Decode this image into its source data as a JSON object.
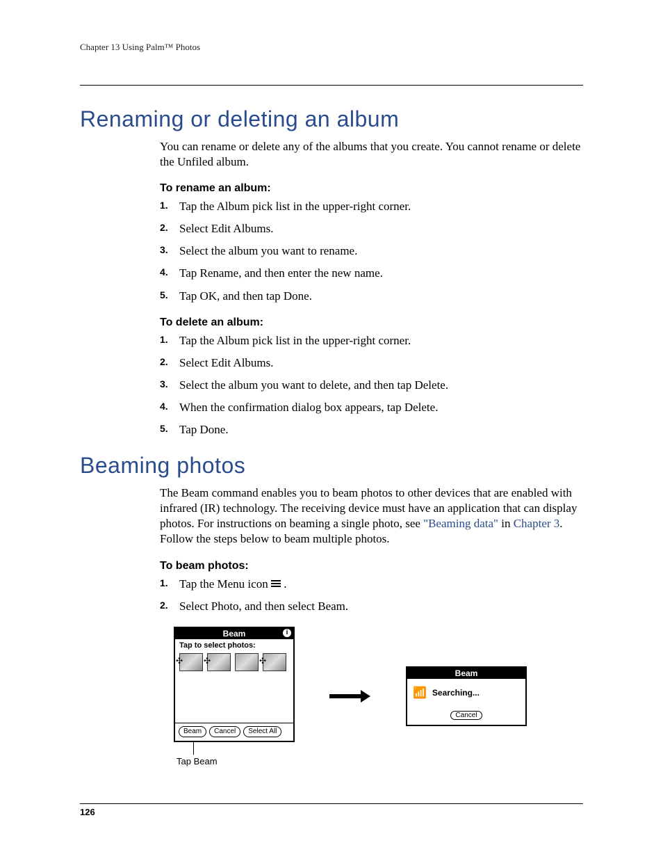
{
  "running_head": "Chapter 13   Using Palm™ Photos",
  "section1": {
    "title": "Renaming or deleting an album",
    "intro": "You can rename or delete any of the albums that you create. You cannot rename or delete the Unfiled album.",
    "rename": {
      "heading": "To rename an album:",
      "steps": [
        "Tap the Album pick list in the upper-right corner.",
        "Select Edit Albums.",
        "Select the album you want to rename.",
        "Tap Rename, and then enter the new name.",
        "Tap OK, and then tap Done."
      ]
    },
    "delete": {
      "heading": "To delete an album:",
      "steps": [
        "Tap the Album pick list in the upper-right corner.",
        "Select Edit Albums.",
        "Select the album you want to delete, and then tap Delete.",
        "When the confirmation dialog box appears, tap Delete.",
        "Tap Done."
      ]
    }
  },
  "section2": {
    "title": "Beaming photos",
    "intro_pre": "The Beam command enables you to beam photos to other devices that are enabled with infrared (IR) technology. The receiving device must have an application that can display photos. For instructions on beaming a single photo, see ",
    "link1": "\"Beaming data\"",
    "intro_mid": " in ",
    "link2": "Chapter 3",
    "intro_post": ". Follow the steps below to beam multiple photos.",
    "beam": {
      "heading": "To beam photos:",
      "step1_pre": "Tap the Menu icon ",
      "step1_post": ".",
      "step2": "Select Photo, and then select Beam."
    }
  },
  "figure": {
    "left": {
      "title": "Beam",
      "subhead": "Tap to select photos:",
      "buttons": [
        "Beam",
        "Cancel",
        "Select All"
      ],
      "callout": "Tap Beam"
    },
    "right": {
      "title": "Beam",
      "status": "Searching...",
      "cancel": "Cancel"
    }
  },
  "page_number": "126"
}
